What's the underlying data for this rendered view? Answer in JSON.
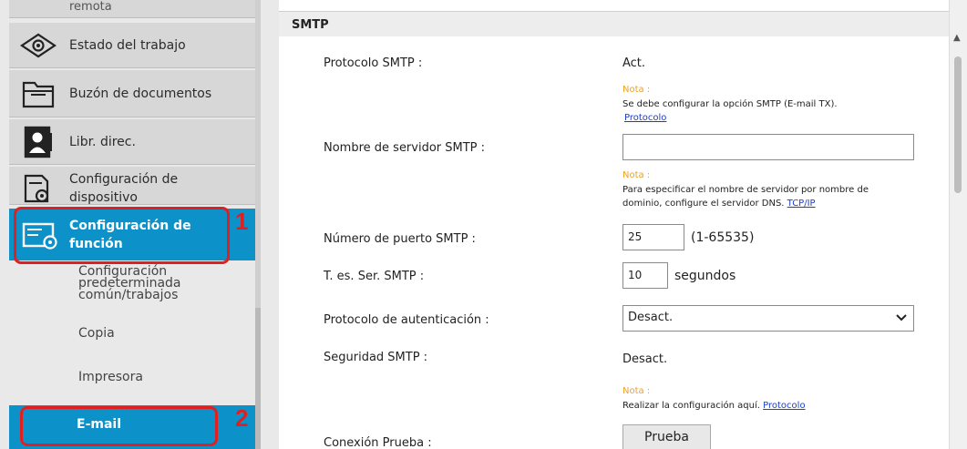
{
  "sidebar": {
    "remote_partial": "remota",
    "items": [
      {
        "label": "Estado del trabajo",
        "icon": "eye-icon"
      },
      {
        "label": "Buzón de documentos",
        "icon": "folder-icon"
      },
      {
        "label": "Libr. direc.",
        "icon": "address-book-icon"
      },
      {
        "label": "Configuración de",
        "label2": "dispositivo",
        "icon": "device-settings-icon"
      },
      {
        "label": "Configuración de",
        "label2": "función",
        "icon": "function-settings-icon"
      }
    ],
    "subitems": [
      {
        "label": "Configuración",
        "label2": "predeterminada",
        "label3": "común/trabajos"
      },
      {
        "label": "Copia"
      },
      {
        "label": "Impresora"
      },
      {
        "label": "E-mail"
      }
    ],
    "callouts": [
      "1",
      "2"
    ]
  },
  "section": {
    "title": "SMTP"
  },
  "rows": {
    "protocol_label": "Protocolo SMTP :",
    "protocol_value": "Act.",
    "note1_title": "Nota :",
    "note1_text": "Se debe configurar la opción SMTP (E-mail TX).",
    "note1_link": "Protocolo",
    "server_label": "Nombre de servidor SMTP :",
    "server_value": "",
    "note2_title": "Nota :",
    "note2_text1": "Para especificar el nombre de servidor por nombre de",
    "note2_text2": "dominio, configure el servidor DNS.",
    "note2_link": "TCP/IP",
    "port_label": "Número de puerto SMTP :",
    "port_value": "25",
    "port_range": "(1-65535)",
    "timeout_label": "T. es. Ser. SMTP :",
    "timeout_value": "10",
    "timeout_unit": "segundos",
    "auth_label": "Protocolo de autenticación :",
    "auth_value": "Desact.",
    "security_label": "Seguridad SMTP :",
    "security_value": "Desact.",
    "note3_title": "Nota :",
    "note3_text": "Realizar la configuración aquí.",
    "note3_link": "Protocolo",
    "test_label": "Conexión Prueba :",
    "test_button": "Prueba"
  },
  "colors": {
    "accent": "#0c92c9",
    "callout": "#e02020",
    "note": "#f0a020",
    "link": "#1a3ecf"
  }
}
